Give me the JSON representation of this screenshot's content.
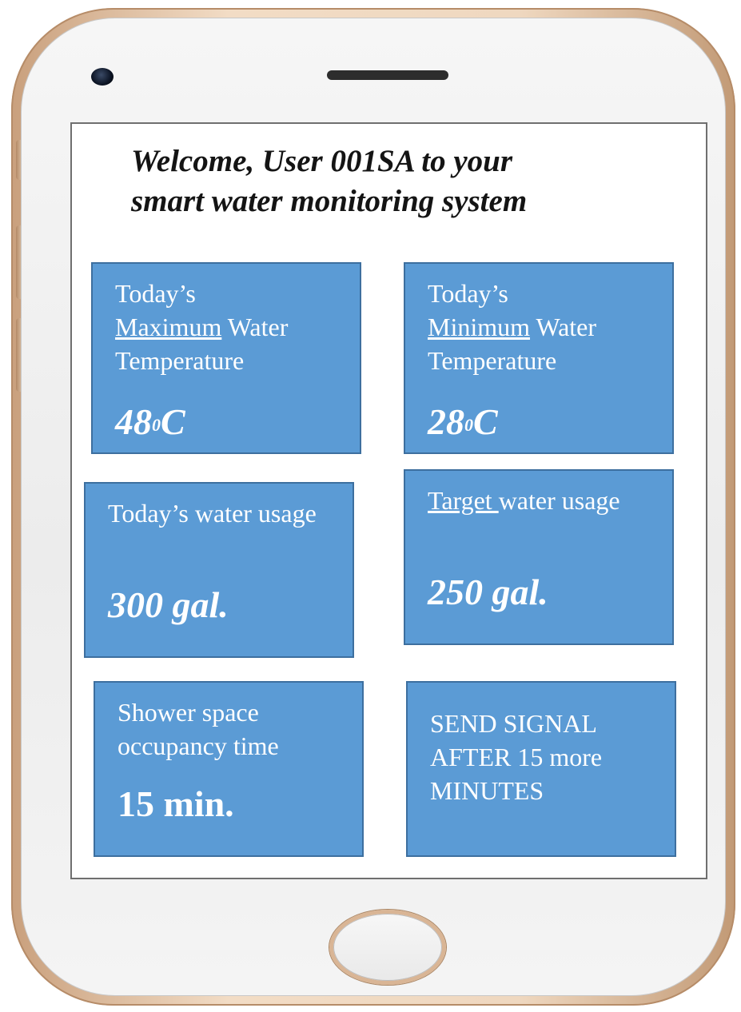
{
  "header": {
    "welcome_line1": "Welcome, User 001SA to your",
    "welcome_line2": "smart water monitoring system"
  },
  "tiles": {
    "max_temp": {
      "prefix": "Today’s",
      "emph": "Maximum",
      "suffix": " Water Temperature",
      "value": "48",
      "unit_sup": "0",
      "unit": "C"
    },
    "min_temp": {
      "prefix": "Today’s",
      "emph": "Minimum",
      "suffix": " Water Temperature",
      "value": "28",
      "unit_sup": "0",
      "unit": "C"
    },
    "usage": {
      "label": "Today’s water usage",
      "value": "300 gal."
    },
    "target": {
      "emph": "Target ",
      "suffix": "water usage",
      "value": "250 gal."
    },
    "shower": {
      "label": "Shower space occupancy time",
      "value": "15 min."
    },
    "signal": {
      "line1": "SEND SIGNAL",
      "line2": "AFTER 15 more",
      "line3": "MINUTES"
    }
  },
  "colors": {
    "tile_bg": "#5b9bd5",
    "tile_border": "#3d6f9f",
    "frame_gold": "#d9b595"
  }
}
